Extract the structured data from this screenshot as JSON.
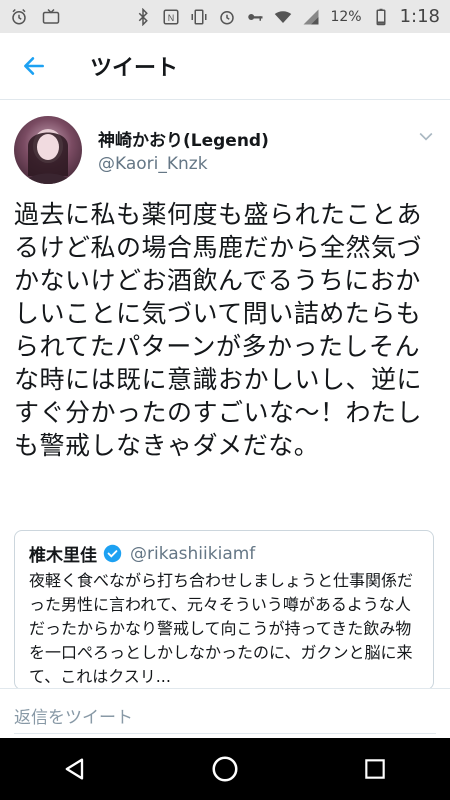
{
  "status_bar": {
    "battery": "12%",
    "time": "1:18"
  },
  "app_bar": {
    "title": "ツイート"
  },
  "tweet": {
    "display_name": "神崎かおり(Legend)",
    "handle": "@Kaori_Knzk",
    "text": "過去に私も薬何度も盛られたことあるけど私の場合馬鹿だから全然気づかないけどお酒飲んでるうちにおかしいことに気づいて問い詰めたらもられてたパターンが多かったしそんな時には既に意識おかしいし、逆にすぐ分かったのすごいな〜！わたしも警戒しなきゃダメだな。"
  },
  "quoted_tweet": {
    "display_name": "椎木里佳",
    "handle": "@rikashiikiamf",
    "text": "夜軽く食べながら打ち合わせしましょうと仕事関係だった男性に言われて、元々そういう噂があるような人だったからかなり警戒して向こうが持ってきた飲み物を一口ぺろっとしかしなかったのに、ガクンと脳に来て、これはクスリ..."
  },
  "reply": {
    "placeholder": "返信をツイート"
  },
  "colors": {
    "accent": "#1da1f2",
    "verified": "#1da1f2",
    "secondary_text": "#657786"
  },
  "icons": [
    "alarm-icon",
    "tv-icon",
    "bluetooth-icon",
    "nfc-icon",
    "vibrate-icon",
    "key-icon",
    "wifi-icon",
    "signal-icon",
    "battery-icon",
    "back-arrow-icon",
    "chevron-down-icon",
    "verified-badge-icon",
    "nav-back-icon",
    "nav-home-icon",
    "nav-recents-icon"
  ]
}
